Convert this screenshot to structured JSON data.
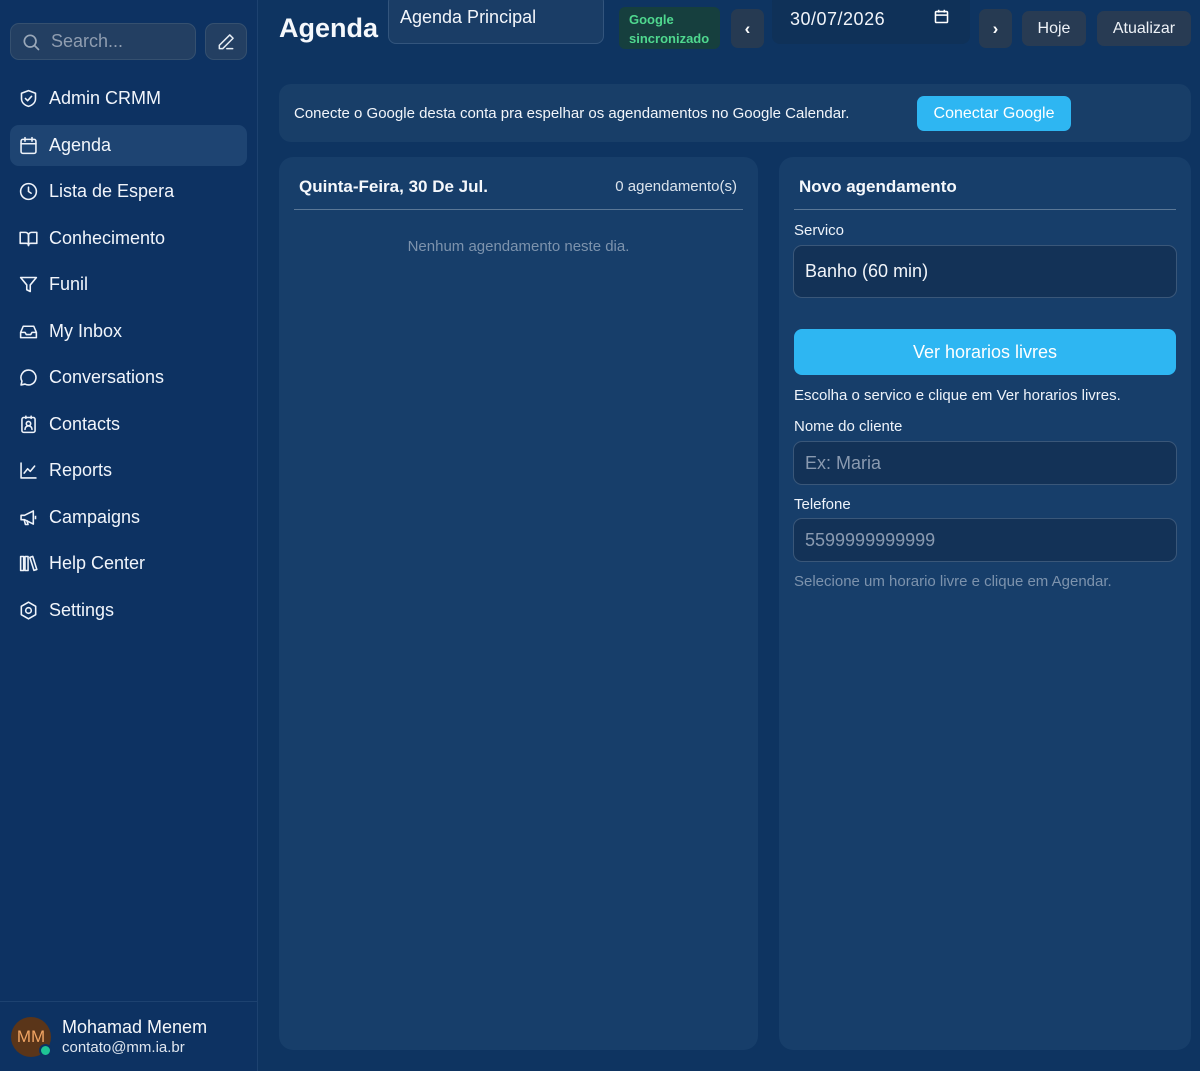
{
  "sidebar": {
    "search_placeholder": "Search...",
    "items": [
      {
        "label": "Admin CRMM",
        "icon": "shield-check-icon"
      },
      {
        "label": "Agenda",
        "icon": "calendar-icon",
        "active": true
      },
      {
        "label": "Lista de Espera",
        "icon": "clock-icon"
      },
      {
        "label": "Conhecimento",
        "icon": "book-open-icon"
      },
      {
        "label": "Funil",
        "icon": "funnel-icon"
      },
      {
        "label": "My Inbox",
        "icon": "inbox-icon"
      },
      {
        "label": "Conversations",
        "icon": "chat-bubble-icon"
      },
      {
        "label": "Contacts",
        "icon": "contact-card-icon"
      },
      {
        "label": "Reports",
        "icon": "line-chart-icon"
      },
      {
        "label": "Campaigns",
        "icon": "megaphone-icon"
      },
      {
        "label": "Help Center",
        "icon": "library-icon"
      },
      {
        "label": "Settings",
        "icon": "settings-hexagon-icon"
      }
    ],
    "profile": {
      "initials": "MM",
      "name": "Mohamad Menem",
      "email": "contato@mm.ia.br",
      "status": "online"
    }
  },
  "header": {
    "title": "Agenda",
    "agenda_select": "Agenda Principal",
    "sync_badge": [
      "Google",
      "sincronizado"
    ],
    "prev_label": "‹",
    "next_label": "›",
    "date_value": "30/07/2026",
    "today_label": "Hoje",
    "refresh_label": "Atualizar"
  },
  "banner": {
    "text": "Conecte o Google desta conta pra espelhar os agendamentos no Google Calendar.",
    "button_label": "Conectar Google"
  },
  "day_panel": {
    "title": "Quinta-Feira, 30 De Jul.",
    "count": "0 agendamento(s)",
    "empty_message": "Nenhum agendamento neste dia."
  },
  "form": {
    "title": "Novo agendamento",
    "service_label": "Servico",
    "service_value": "Banho (60 min)",
    "find_slots_label": "Ver horarios livres",
    "service_hint": "Escolha o servico e clique em Ver horarios livres.",
    "client_label": "Nome do cliente",
    "client_placeholder": "Ex: Maria",
    "phone_label": "Telefone",
    "phone_placeholder": "5599999999999",
    "schedule_hint": "Selecione um horario livre e clique em Agendar."
  },
  "colors": {
    "background": "#0e3461",
    "panel": "#173e6a",
    "accent": "#2eb6f2",
    "sync_green": "#4fd88f",
    "online": "#1ec495"
  }
}
